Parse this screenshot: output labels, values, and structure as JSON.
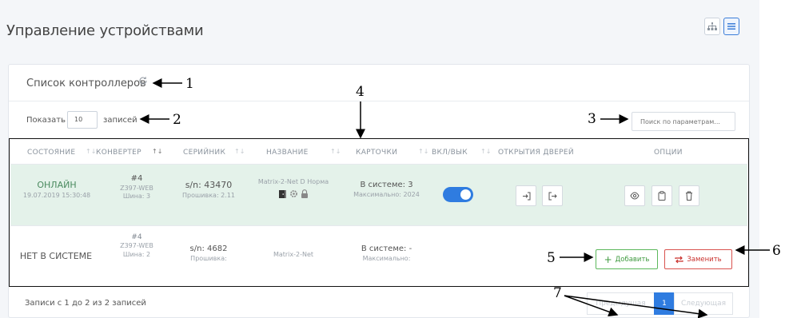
{
  "page": {
    "title": "Управление устройствами"
  },
  "card": {
    "title": "Список контроллеров"
  },
  "length": {
    "show_label": "Показать",
    "value": "10",
    "records_label": "записей"
  },
  "search": {
    "placeholder": "Поиск по параметрам..."
  },
  "table": {
    "headers": [
      "СОСТОЯНИЕ",
      "КОНВЕРТЕР",
      "СЕРИЙНИК",
      "НАЗВАНИЕ",
      "КАРТОЧКИ",
      "ВКЛ/ВЫК",
      "ОТКРЫТИЯ ДВЕРЕЙ",
      "ОПЦИИ"
    ],
    "rows": [
      {
        "status": "ОНЛАЙН",
        "status_time": "19.07.2019 15:30:48",
        "converter_num": "#4",
        "converter_model": "Z397-WEB",
        "converter_bus": "Шина: 3",
        "serial": "s/n: 43470",
        "firmware": "Прошивка: 2.11",
        "name": "Matrix-2-Net D Норма",
        "cards_in_system": "В системе: 3",
        "cards_max": "Максимально: 2024",
        "enabled": true
      },
      {
        "status": "НЕТ В СИСТЕМЕ",
        "converter_num": "#4",
        "converter_model": "Z397-WEB",
        "converter_bus": "Шина: 2",
        "serial": "s/n: 4682",
        "firmware": "Прошивка:",
        "name": "Matrix-2-Net",
        "cards_in_system": "В системе: -",
        "cards_max": "Максимально:",
        "add_label": "Добавить",
        "replace_label": "Заменить"
      }
    ]
  },
  "footer": {
    "info": "Записи с 1 до 2 из 2 записей",
    "prev_label": "Предыдущая",
    "current_page": "1",
    "next_label": "Следующая"
  },
  "callouts": [
    "1",
    "2",
    "3",
    "4",
    "5",
    "6",
    "7"
  ],
  "colors": {
    "primary": "#2f7ce0",
    "success": "#5cb85c",
    "danger": "#d9534f",
    "online_row": "#e4f2ea"
  }
}
